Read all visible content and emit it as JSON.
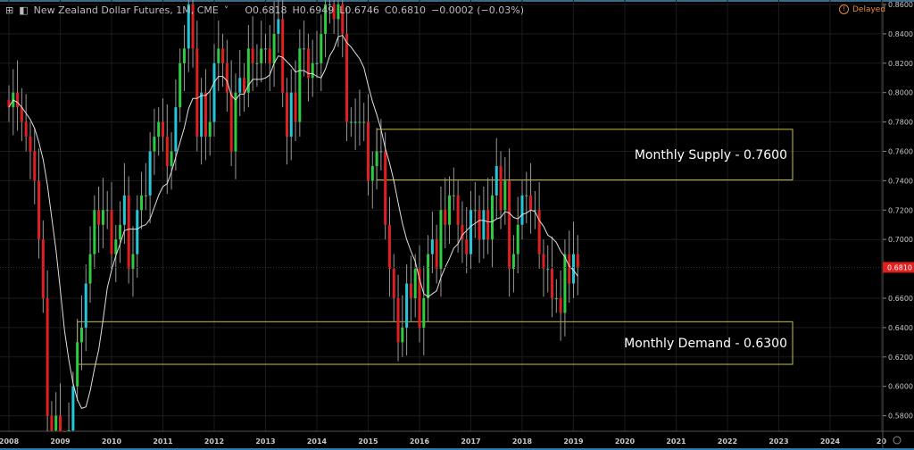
{
  "header": {
    "symbol_title": "New Zealand Dollar Futures, 1M, CME",
    "open": "O0.6818",
    "high": "H0.6949",
    "low": "L0.6746",
    "close": "C0.6810",
    "change": "−0.0002 (−0.03%)",
    "delayed_label": "Delayed"
  },
  "colors": {
    "up": "#26c6da",
    "up_alt": "#2ecc40",
    "down": "#e02020",
    "ma": "#e0e0e0",
    "zone": "#c8c040",
    "price_tag": "#e02020"
  },
  "chart_data": {
    "type": "candlestick",
    "title": "New Zealand Dollar Futures, 1M, CME",
    "start": "2008-01",
    "interval": "1M",
    "closes": [
      0.79,
      0.8,
      0.79,
      0.78,
      0.77,
      0.76,
      0.74,
      0.7,
      0.66,
      0.58,
      0.57,
      0.58,
      0.52,
      0.5,
      0.57,
      0.6,
      0.63,
      0.64,
      0.67,
      0.69,
      0.72,
      0.71,
      0.72,
      0.72,
      0.69,
      0.7,
      0.71,
      0.73,
      0.68,
      0.69,
      0.72,
      0.73,
      0.73,
      0.76,
      0.77,
      0.78,
      0.77,
      0.75,
      0.76,
      0.79,
      0.82,
      0.83,
      0.86,
      0.83,
      0.77,
      0.8,
      0.77,
      0.78,
      0.82,
      0.83,
      0.82,
      0.8,
      0.76,
      0.8,
      0.81,
      0.8,
      0.83,
      0.82,
      0.82,
      0.83,
      0.83,
      0.82,
      0.84,
      0.85,
      0.8,
      0.77,
      0.8,
      0.78,
      0.83,
      0.83,
      0.81,
      0.82,
      0.82,
      0.84,
      0.86,
      0.86,
      0.85,
      0.86,
      0.84,
      0.78,
      0.78,
      0.78,
      0.78,
      0.78,
      0.74,
      0.75,
      0.76,
      0.76,
      0.71,
      0.68,
      0.66,
      0.63,
      0.64,
      0.67,
      0.66,
      0.68,
      0.64,
      0.66,
      0.69,
      0.7,
      0.68,
      0.72,
      0.71,
      0.73,
      0.73,
      0.71,
      0.7,
      0.69,
      0.72,
      0.72,
      0.7,
      0.72,
      0.7,
      0.73,
      0.75,
      0.72,
      0.74,
      0.68,
      0.69,
      0.71,
      0.73,
      0.73,
      0.72,
      0.72,
      0.69,
      0.68,
      0.68,
      0.66,
      0.66,
      0.65,
      0.69,
      0.67,
      0.69,
      0.681
    ],
    "moving_average_period": 10,
    "ylim": [
      0.565,
      0.863
    ],
    "y_ticks": [
      "0.8600",
      "0.8400",
      "0.8200",
      "0.8000",
      "0.7800",
      "0.7600",
      "0.7400",
      "0.7200",
      "0.7000",
      "0.6600",
      "0.6400",
      "0.6200",
      "0.6000",
      "0.5800"
    ],
    "x_ticks": [
      "2008",
      "2009",
      "2010",
      "2011",
      "2012",
      "2013",
      "2014",
      "2015",
      "2016",
      "2017",
      "2018",
      "2019",
      "2020",
      "2021",
      "2022",
      "2023",
      "2024",
      "20"
    ],
    "last_price": "0.6810",
    "zones": [
      {
        "label": "Monthly Supply - 0.7600",
        "from": "2015-03",
        "top": 0.775,
        "bottom": 0.7405
      },
      {
        "label": "Monthly Demand - 0.6300",
        "from": "2009-05",
        "top": 0.644,
        "bottom": 0.615
      }
    ]
  }
}
